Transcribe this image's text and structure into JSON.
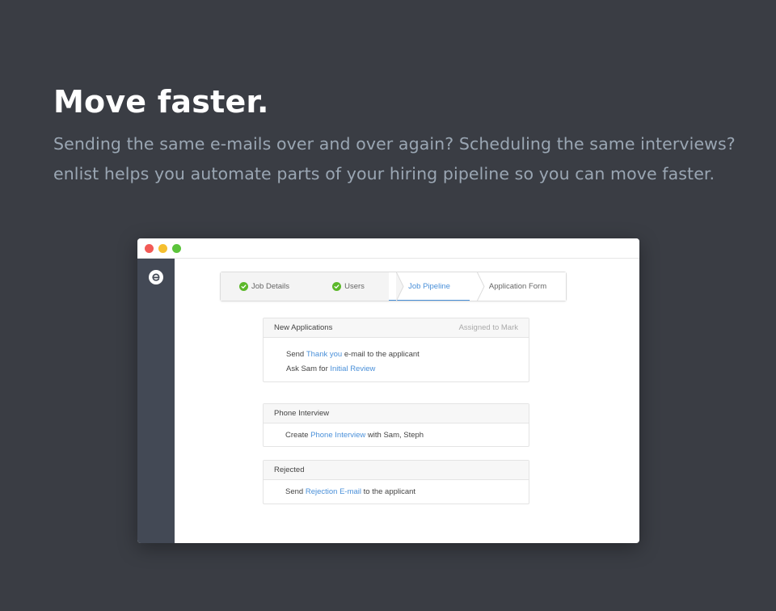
{
  "hero": {
    "title": "Move faster.",
    "subtitle": "Sending the same e-mails over and over again? Scheduling the same interviews? enlist helps you automate parts of your hiring pipeline so you can move faster."
  },
  "colors": {
    "background": "#3a3d44",
    "sidebar": "#434955",
    "link": "#4a90d9",
    "check": "#5cb82a"
  },
  "window": {
    "controls": [
      "close",
      "minimize",
      "maximize"
    ],
    "logo": "enlist-logo"
  },
  "steps": [
    {
      "label": "Job Details",
      "status": "done"
    },
    {
      "label": "Users",
      "status": "done"
    },
    {
      "label": "Job Pipeline",
      "status": "active"
    },
    {
      "label": "Application Form",
      "status": "pending"
    }
  ],
  "cards": [
    {
      "title": "New Applications",
      "assigned": "Assigned to Mark",
      "lines": [
        {
          "pre": "Send ",
          "link": "Thank you",
          "post": " e-mail to the applicant"
        },
        {
          "pre": "Ask Sam for ",
          "link": "Initial Review",
          "post": ""
        }
      ]
    },
    {
      "title": "Phone Interview",
      "assigned": "",
      "lines": [
        {
          "pre": "Create ",
          "link": "Phone Interview",
          "post": " with Sam, Steph"
        }
      ]
    },
    {
      "title": "Rejected",
      "assigned": "",
      "lines": [
        {
          "pre": "Send ",
          "link": "Rejection E-mail",
          "post": " to the applicant"
        }
      ]
    }
  ]
}
